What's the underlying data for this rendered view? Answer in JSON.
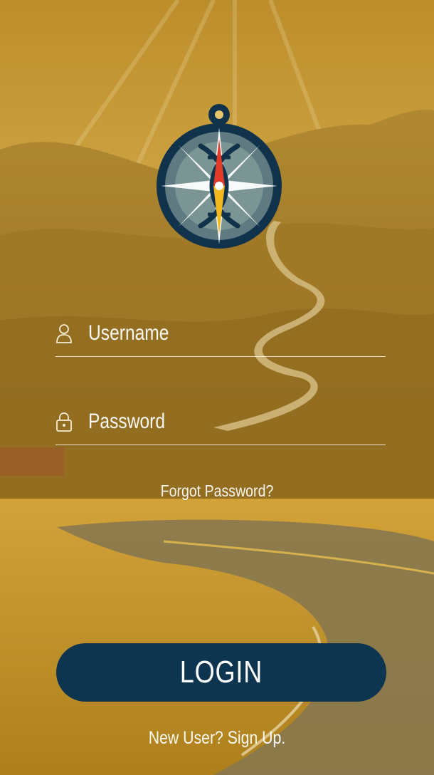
{
  "colors": {
    "overlay": "#c9992f",
    "button_bg": "#0d3550",
    "text": "#ffffff",
    "logo_navy": "#10324b",
    "logo_accent_red": "#e23b2a",
    "logo_accent_yellow": "#f2b81c"
  },
  "logo": {
    "icon": "compass-dna-icon"
  },
  "form": {
    "username": {
      "placeholder": "Username",
      "value": "",
      "icon": "user-icon"
    },
    "password": {
      "placeholder": "Password",
      "value": "",
      "icon": "lock-icon"
    },
    "forgot_label": "Forgot Password?",
    "login_label": "LOGIN",
    "signup_label": "New User? Sign Up."
  }
}
